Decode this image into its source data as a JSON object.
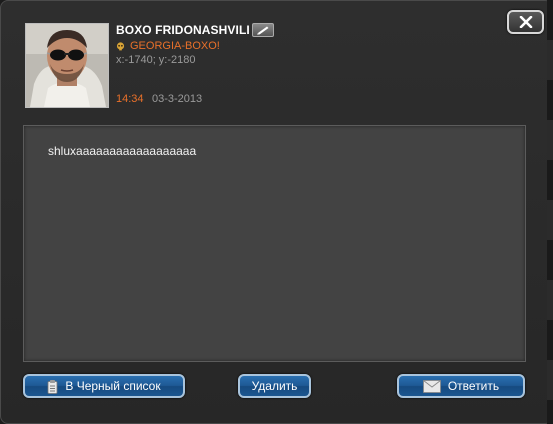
{
  "sender": {
    "name": "BOXO FRIDONASHVILI",
    "alliance": "GEORGIA-BOXO!",
    "coords": "x:-1740; y:-2180"
  },
  "message": {
    "time": "14:34",
    "date": "03-3-2013",
    "body": "shluxaaaaaaaaaaaaaaaaaa"
  },
  "buttons": {
    "blacklist": "В Черный список",
    "delete": "Удалить",
    "reply": "Ответить"
  },
  "icons": {
    "close": "close-icon",
    "edit": "pencil-icon",
    "alliance": "skull-icon",
    "blacklist": "clipboard-icon",
    "reply": "envelope-icon"
  },
  "colors": {
    "accent_orange": "#e8702a",
    "button_blue": "#1e5995",
    "panel_dark": "#2e2e2e",
    "message_bg": "#434343"
  }
}
